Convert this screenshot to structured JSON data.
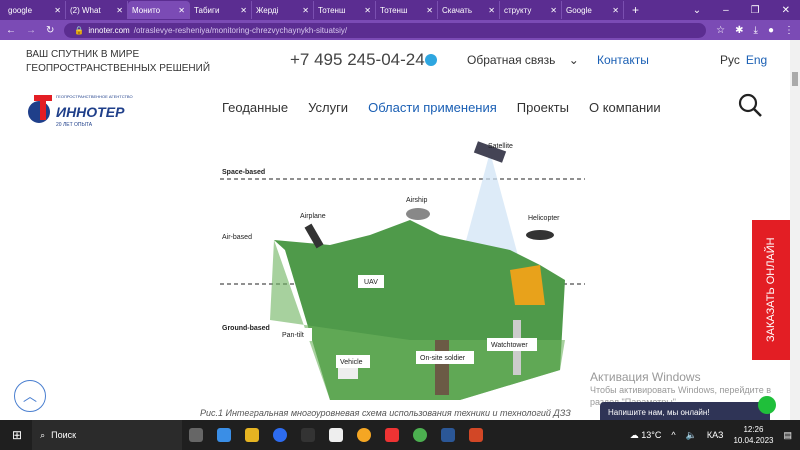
{
  "browser": {
    "tabs": [
      {
        "label": "google",
        "active": false
      },
      {
        "label": "(2) What",
        "active": false
      },
      {
        "label": "Монито",
        "active": true
      },
      {
        "label": "Табиги",
        "active": false
      },
      {
        "label": "Жерді",
        "active": false
      },
      {
        "label": "Тотенш",
        "active": false
      },
      {
        "label": "Тотенш",
        "active": false
      },
      {
        "label": "Скачать",
        "active": false
      },
      {
        "label": "структу",
        "active": false
      },
      {
        "label": "Google",
        "active": false
      }
    ],
    "url_domain": "innoter.com",
    "url_path": "/otraslevye-resheniya/monitoring-chrezvychaynykh-situatsiy/"
  },
  "header": {
    "tagline1": "ВАШ СПУТНИК В МИРЕ",
    "tagline2": "ГЕОПРОСТРАНСТВЕННЫХ РЕШЕНИЙ",
    "phone": "+7 495 245-04-24",
    "feedback": "Обратная связь",
    "contacts": "Контакты",
    "lang_ru": "Рус",
    "lang_en": "Eng",
    "logo": {
      "name": "ИННОТЕР",
      "sub": "ГЕОПРОСТРАНСТВЕННОЕ АГЕНТСТВО",
      "years": "20 ЛЕТ ОПЫТА"
    },
    "nav": [
      "Геоданные",
      "Услуги",
      "Области применения",
      "Проекты",
      "О компании"
    ]
  },
  "figure": {
    "labels": {
      "satellite": "Satellite",
      "space": "Space-based",
      "airplane": "Airplane",
      "airship": "Airship",
      "helicopter": "Helicopter",
      "air": "Air-based",
      "uav": "UAV",
      "pantilt": "Pan-tilt",
      "vehicle": "Vehicle",
      "soldier": "On-site soldier",
      "watchtower": "Watchtower",
      "ground": "Ground-based"
    },
    "caption": "Рис.1 Интегральная многоуровневая схема использования техники и технологий ДЗЗ"
  },
  "order_button": "ЗАКАЗАТЬ ОНЛАЙН",
  "windows": {
    "title": "Активация Windows",
    "text1": "Чтобы активировать Windows, перейдите в",
    "text2": "раздел \"Параметры\"."
  },
  "chat": "Напишите нам, мы онлайн!",
  "taskbar": {
    "search": "Поиск",
    "temp": "13°C",
    "lang": "КАЗ",
    "time": "12:26",
    "date": "10.04.2023"
  }
}
